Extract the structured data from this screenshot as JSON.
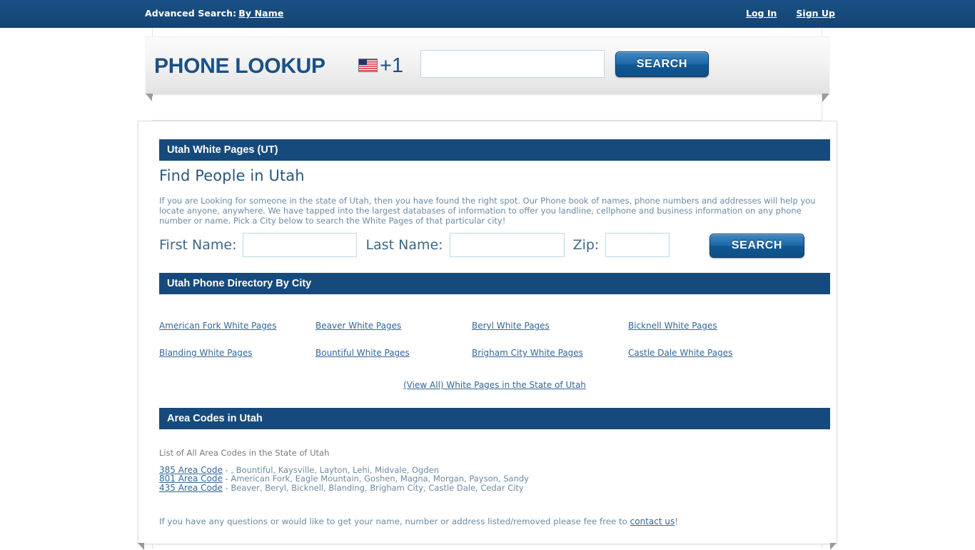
{
  "topbar": {
    "advanced_search_label": "Advanced Search:",
    "by_name_link": "By Name",
    "log_in": "Log In",
    "sign_up": "Sign Up"
  },
  "lookup": {
    "title": "PHONE LOOKUP",
    "flag_icon": "us-flag-icon",
    "country_code": "+1",
    "phone_value": "",
    "phone_placeholder": "",
    "search_label": "SEARCH"
  },
  "state_panel": {
    "header": "Utah White Pages (UT)",
    "heading": "Find People in Utah",
    "intro": "If you are Looking for someone in the state of Utah, then you have found the right spot. Our Phone book of names, phone numbers and addresses will help you locate anyone, anywhere. We have tapped into the largest databases of information to offer you landline, cellphone and business information on any phone number or name. Pick a City below to search the White Pages of that particular city!"
  },
  "name_form": {
    "first_name_label": "First Name:",
    "first_name_value": "",
    "last_name_label": "Last Name:",
    "last_name_value": "",
    "zip_label": "Zip:",
    "zip_value": "",
    "search_label": "SEARCH"
  },
  "city_directory": {
    "header": "Utah Phone Directory By City",
    "rows": [
      [
        "American Fork White Pages",
        "Beaver White Pages",
        "Beryl White Pages",
        "Bicknell White Pages"
      ],
      [
        "Blanding White Pages",
        "Bountiful White Pages",
        "Brigham City White Pages",
        "Castle Dale White Pages"
      ]
    ],
    "view_all": "(View All) White Pages in the State of Utah"
  },
  "area_codes": {
    "header": "Area Codes in Utah",
    "intro": "List of All Area Codes in the State of Utah",
    "items": [
      {
        "code": "385 Area Code",
        "cities": " - , Bountiful, Kaysville, Layton, Lehi, Midvale, Ogden"
      },
      {
        "code": "801 Area Code",
        "cities": " - American Fork, Eagle Mountain, Goshen, Magna, Morgan, Payson, Sandy"
      },
      {
        "code": "435 Area Code",
        "cities": " - Beaver, Beryl, Bicknell, Blanding, Brigham City, Castle Dale, Cedar City"
      }
    ]
  },
  "footer": {
    "contact_text_before": "If you have any questions or would like to get your name, number or address listed/removed please fee free to ",
    "contact_link": "contact us",
    "contact_text_after": "!"
  },
  "colors": {
    "brand_blue": "#174a7c",
    "link_blue": "#336699",
    "text_blue": "#6a8ba5"
  }
}
